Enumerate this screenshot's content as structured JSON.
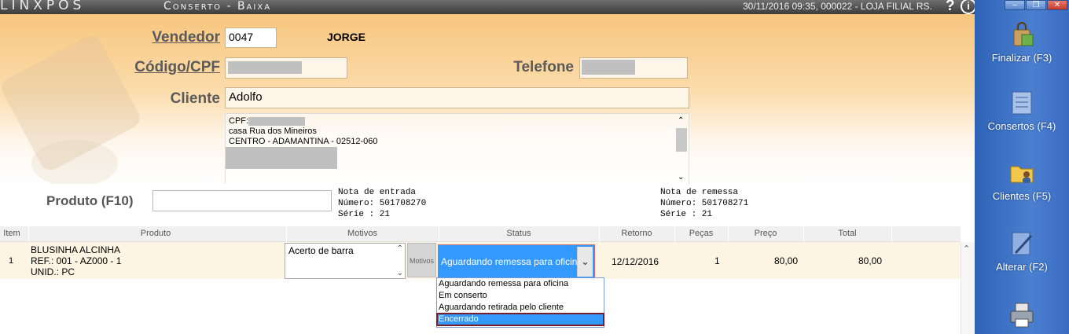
{
  "titlebar": {
    "brand": "LINXPOS",
    "title": "Conserto - Baixa",
    "info": "30/11/2016 09:35, 000022 - LOJA FILIAL RS.",
    "help": "?",
    "info_icon": "i"
  },
  "form": {
    "vendedor_label": "Vendedor",
    "vendedor_code": "0047",
    "vendedor_name": "JORGE",
    "codigo_label": "Código/CPF",
    "telefone_label": "Telefone",
    "cliente_label": "Cliente",
    "cliente_value": "Adolfo",
    "address": {
      "line1": "CPF:",
      "line2": "casa Rua dos Mineiros",
      "line3": "CENTRO - ADAMANTINA - 02512-060"
    }
  },
  "produto": {
    "label": "Produto (F10)",
    "value": "",
    "nota_entrada": "Nota de entrada\nNúmero: 501708270\nSérie : 21",
    "nota_remessa": "Nota de remessa\nNúmero: 501708271\nSérie : 21"
  },
  "grid": {
    "headers": {
      "item": "Item",
      "produto": "Produto",
      "motivos": "Motivos",
      "status": "Status",
      "retorno": "Retorno",
      "pecas": "Peças",
      "preco": "Preço",
      "total": "Total"
    },
    "rows": [
      {
        "item": "1",
        "produto_l1": "BLUSINHA ALCINHA",
        "produto_l2": "REF.: 001 - AZ000 - 1",
        "produto_l3": "UNID.: PC",
        "motivo": "Acerto de barra",
        "motivos_button": "Motivos",
        "status": "Aguardando remessa para oficina",
        "retorno": "12/12/2016",
        "pecas": "1",
        "preco": "80,00",
        "total": "80,00"
      }
    ],
    "status_options": [
      "Aguardando remessa para oficina",
      "Em conserto",
      "Aguardando retirada pelo cliente",
      "Encerrado"
    ],
    "status_highlighted": "Encerrado"
  },
  "sidebar": {
    "buttons": [
      {
        "label": "Finalizar (F3)",
        "icon": "shopping-bag-icon"
      },
      {
        "label": "Consertos (F4)",
        "icon": "document-list-icon"
      },
      {
        "label": "Clientes (F5)",
        "icon": "folder-user-icon"
      },
      {
        "label": "Alterar (F2)",
        "icon": "edit-pencil-icon"
      },
      {
        "label": "",
        "icon": "printer-icon"
      }
    ]
  },
  "colors": {
    "header_top": "#f8c67e",
    "sidebar": "#3a6cc2",
    "selected": "#3399ff"
  }
}
